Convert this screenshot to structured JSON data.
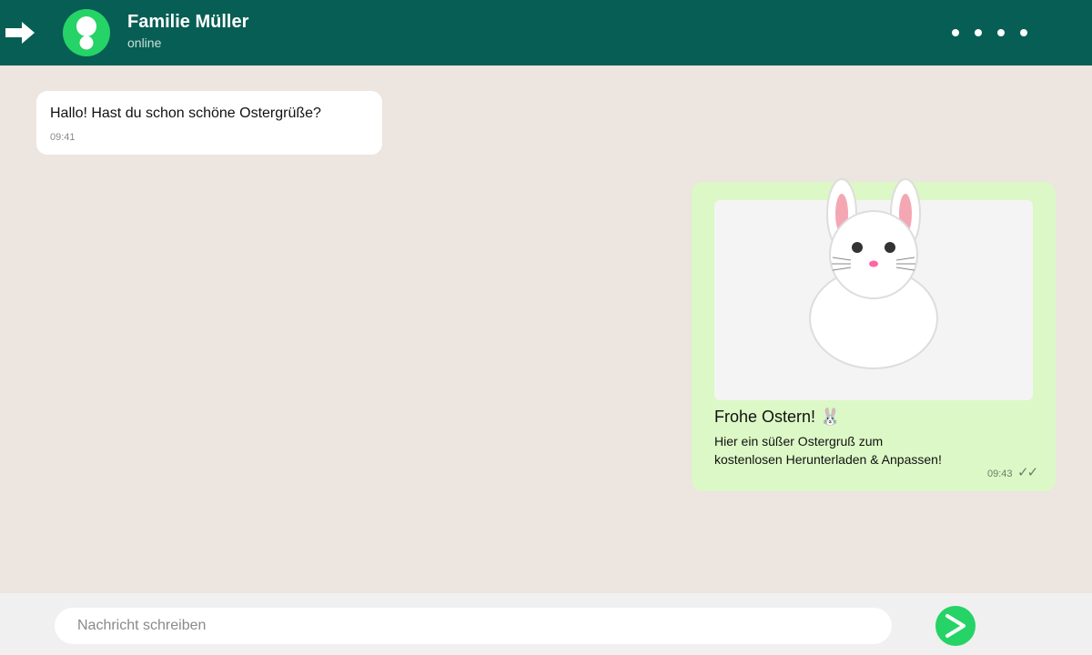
{
  "header": {
    "contact_name": "Familie Müller",
    "status": "online",
    "back_icon": "arrow-right-icon",
    "avatar_icon": "person-icon",
    "menu_icon": "more-dots-icon"
  },
  "messages": {
    "incoming": {
      "text": "Hallo! Hast du schon schöne Ostergrüße?",
      "time": "09:41"
    },
    "outgoing": {
      "image": "easter-bunny-illustration",
      "title": "Frohe Ostern! 🐰",
      "body_line1": "Hier ein süßer Ostergruß zum",
      "body_line2": "kostenlosen Herunterladen & Anpassen!",
      "time": "09:43",
      "ticks": "✓✓"
    }
  },
  "composer": {
    "placeholder": "Nachricht schreiben",
    "value": "",
    "send_icon": "send-arrow-icon"
  },
  "colors": {
    "header": "#075e54",
    "accent": "#25d366",
    "chat_background": "#ece5e0",
    "outgoing_bubble": "#dcf8c6",
    "incoming_bubble": "#ffffff"
  }
}
